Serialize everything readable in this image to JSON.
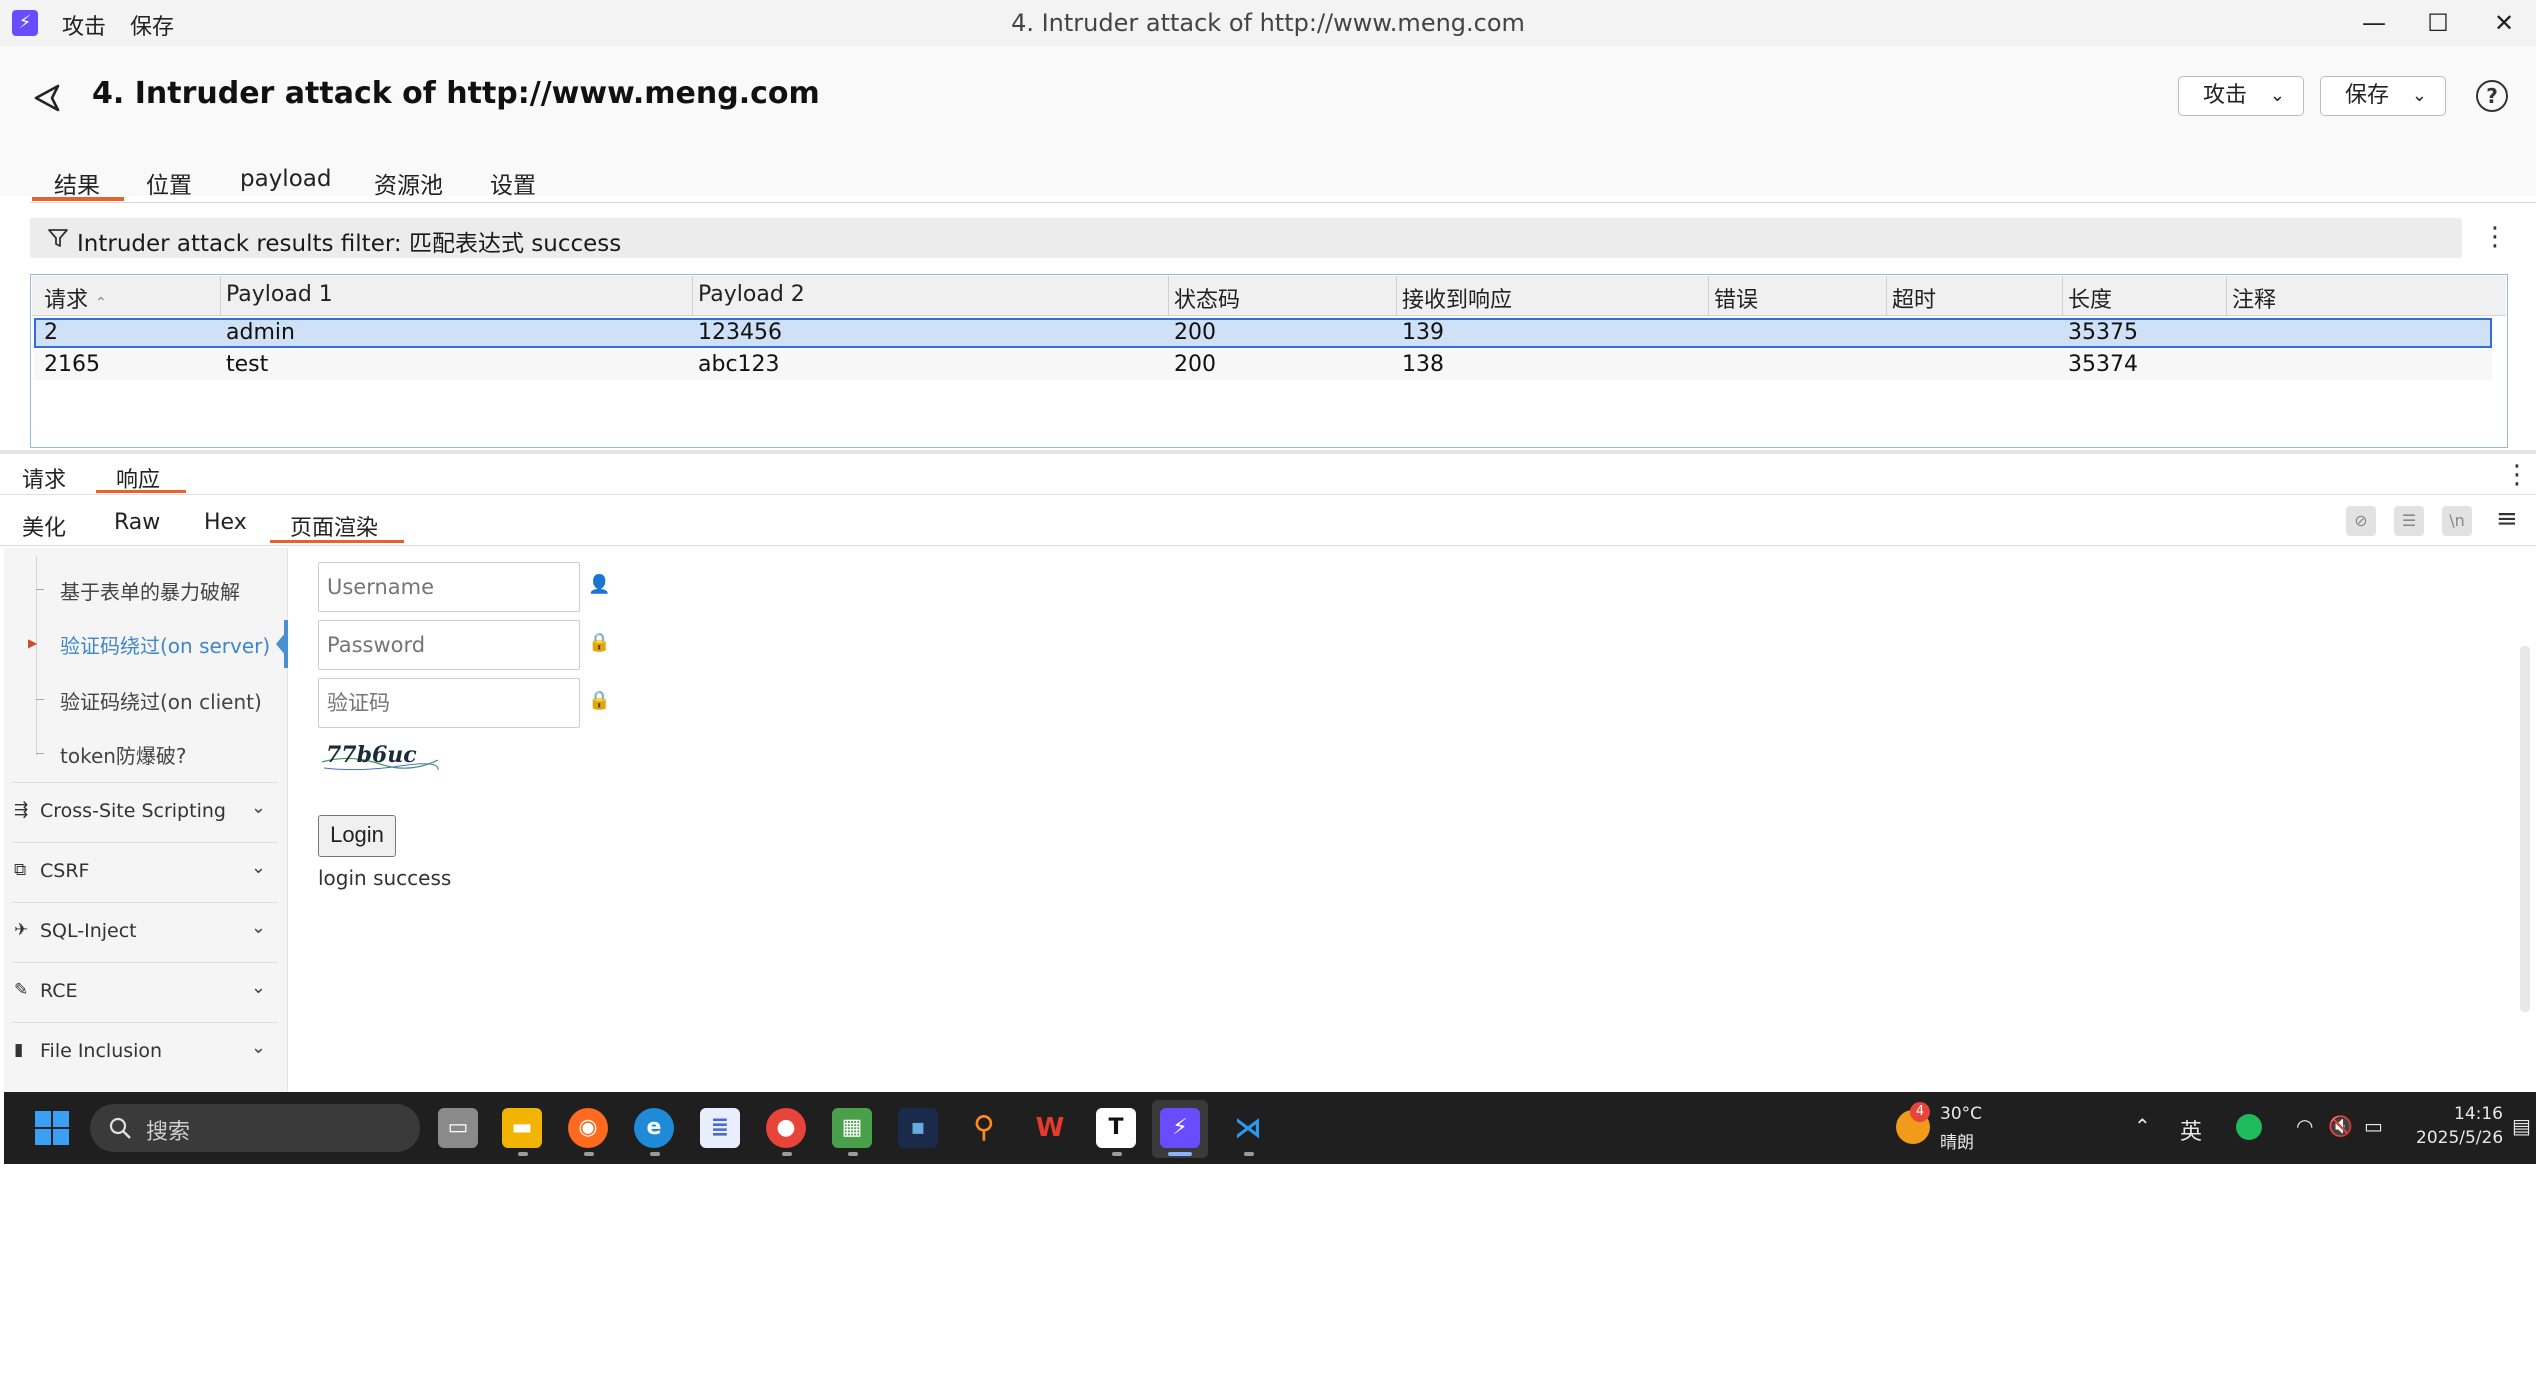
{
  "titlebar": {
    "menu": [
      "攻击",
      "保存"
    ],
    "window_title": "4. Intruder attack of http://www.meng.com"
  },
  "header": {
    "title": "4. Intruder attack of http://www.meng.com",
    "attack_btn": "攻击",
    "save_btn": "保存"
  },
  "tabs": [
    "结果",
    "位置",
    "payload",
    "资源池",
    "设置"
  ],
  "filter": {
    "text": "Intruder attack results filter: 匹配表达式 success"
  },
  "table": {
    "columns": [
      "请求",
      "Payload 1",
      "Payload 2",
      "状态码",
      "接收到响应",
      "错误",
      "超时",
      "长度",
      "注释"
    ],
    "rows": [
      {
        "request": "2",
        "payload1": "admin",
        "payload2": "123456",
        "status": "200",
        "received": "139",
        "error": "",
        "timeout": "",
        "length": "35375",
        "comment": ""
      },
      {
        "request": "2165",
        "payload1": "test",
        "payload2": "abc123",
        "status": "200",
        "received": "138",
        "error": "",
        "timeout": "",
        "length": "35374",
        "comment": ""
      }
    ]
  },
  "message_tabs": [
    "请求",
    "响应"
  ],
  "view_tabs": [
    "美化",
    "Raw",
    "Hex",
    "页面渲染"
  ],
  "rendered": {
    "sidebar_sub": [
      "基于表单的暴力破解",
      "验证码绕过(on server)",
      "验证码绕过(on client)",
      "token防爆破?"
    ],
    "sidebar_main": [
      {
        "label": "Cross-Site Scripting",
        "icon": "⇶"
      },
      {
        "label": "CSRF",
        "icon": "⧉"
      },
      {
        "label": "SQL-Inject",
        "icon": "✈"
      },
      {
        "label": "RCE",
        "icon": "✎"
      },
      {
        "label": "File Inclusion",
        "icon": "▮"
      }
    ],
    "username_placeholder": "Username",
    "password_placeholder": "Password",
    "captcha_placeholder": "验证码",
    "captcha_text": "77b6uc",
    "login_btn": "Login",
    "message": "login success"
  },
  "taskbar": {
    "search": "搜索",
    "weather_temp": "30°C",
    "weather_desc": "晴朗",
    "weather_badge": "4",
    "ime": "英",
    "time": "14:16",
    "date": "2025/5/26"
  },
  "colors": {
    "accent": "#e8622c",
    "selection": "#cfe0f7",
    "link": "#2f6fd6"
  }
}
